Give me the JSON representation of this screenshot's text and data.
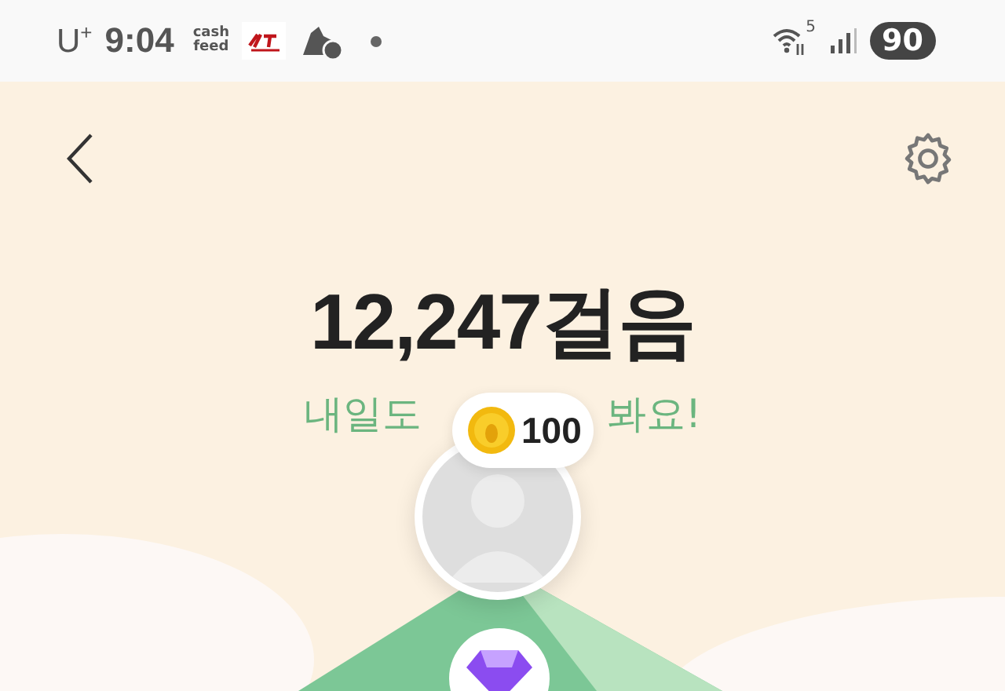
{
  "status_bar": {
    "carrier": "U",
    "carrier_mark": "+",
    "time": "9:04",
    "app_logo_lines": [
      "cash",
      "feed"
    ],
    "network": "5",
    "battery": "90"
  },
  "steps": {
    "count": "12,247걸음",
    "subtitle_parts": [
      "내일도",
      "봐요!"
    ]
  },
  "reward_bubble": {
    "amount": "100"
  }
}
